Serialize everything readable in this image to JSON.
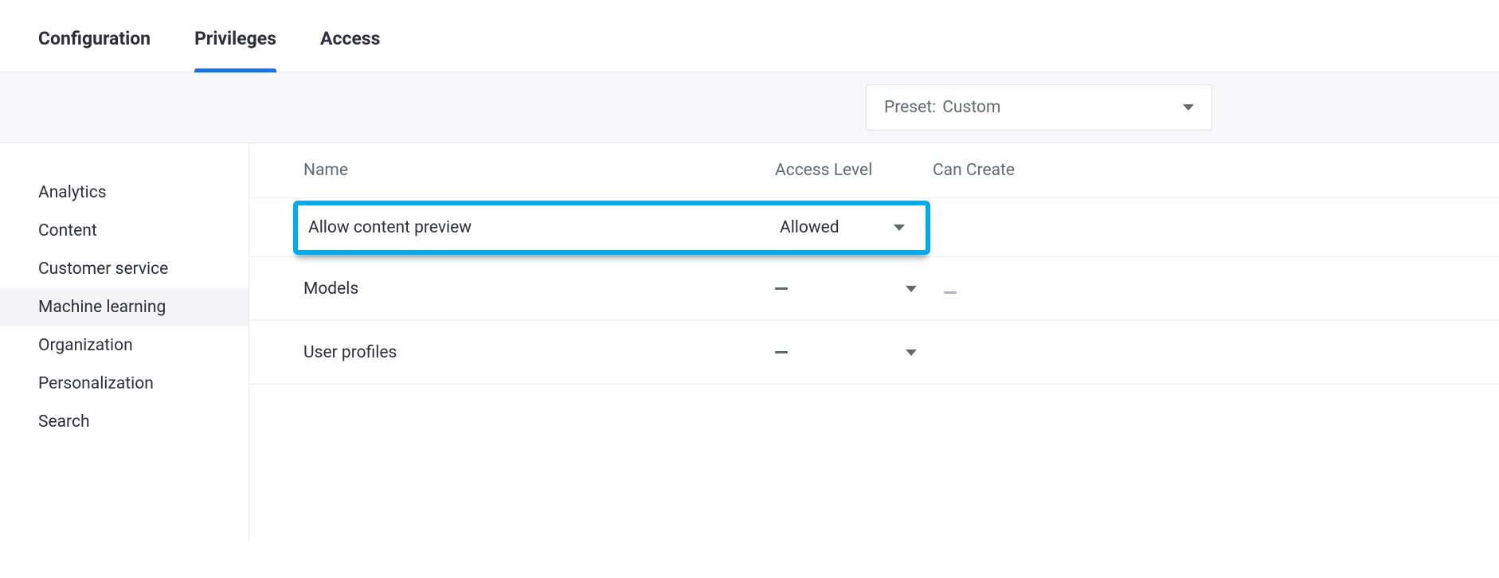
{
  "tabs": [
    {
      "label": "Configuration"
    },
    {
      "label": "Privileges"
    },
    {
      "label": "Access"
    }
  ],
  "active_tab_index": 1,
  "preset": {
    "label": "Preset:",
    "value": "Custom"
  },
  "sidebar": {
    "items": [
      {
        "label": "Analytics"
      },
      {
        "label": "Content"
      },
      {
        "label": "Customer service"
      },
      {
        "label": "Machine learning"
      },
      {
        "label": "Organization"
      },
      {
        "label": "Personalization"
      },
      {
        "label": "Search"
      }
    ],
    "active_index": 3
  },
  "table": {
    "columns": {
      "name": "Name",
      "access": "Access Level",
      "create": "Can Create"
    },
    "rows": [
      {
        "name": "Allow content preview",
        "access_label": "Allowed",
        "access_type": "value",
        "can_create": null,
        "highlighted": true
      },
      {
        "name": "Models",
        "access_label": null,
        "access_type": "dash",
        "can_create": "dash"
      },
      {
        "name": "User profiles",
        "access_label": null,
        "access_type": "dash",
        "can_create": null
      }
    ]
  }
}
